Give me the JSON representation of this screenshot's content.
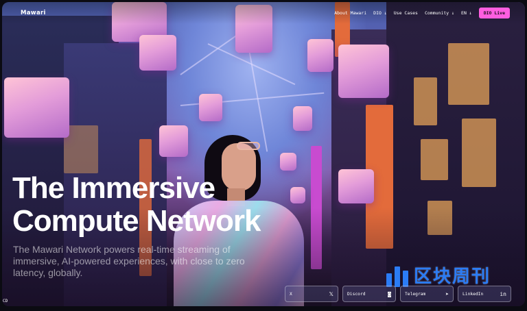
{
  "header": {
    "logo": "Mawari",
    "nav": [
      {
        "label": "About Mawari"
      },
      {
        "label": "DIO ↓"
      },
      {
        "label": "Use Cases"
      },
      {
        "label": "Community ↓"
      },
      {
        "label": "EN ↓"
      }
    ],
    "cta_label": "DIO Live"
  },
  "hero": {
    "title_line1": "The Immersive",
    "title_line2": "Compute Network",
    "subtitle": "The Mawari Network powers real-time streaming of immersive, AI-powered experiences, with close to zero latency, globally."
  },
  "socials": [
    {
      "label": "X",
      "icon": "x-icon",
      "glyph": "𝕏"
    },
    {
      "label": "Discord",
      "icon": "discord-icon",
      "glyph": "◙"
    },
    {
      "label": "Telegram",
      "icon": "telegram-icon",
      "glyph": "➤"
    },
    {
      "label": "LinkedIn",
      "icon": "linkedin-icon",
      "glyph": "in"
    }
  ],
  "watermark": {
    "text": "区块周刊"
  },
  "mini_control": {
    "label": "CD"
  },
  "colors": {
    "accent": "#ff5ee0",
    "watermark": "#2b7cf5"
  }
}
